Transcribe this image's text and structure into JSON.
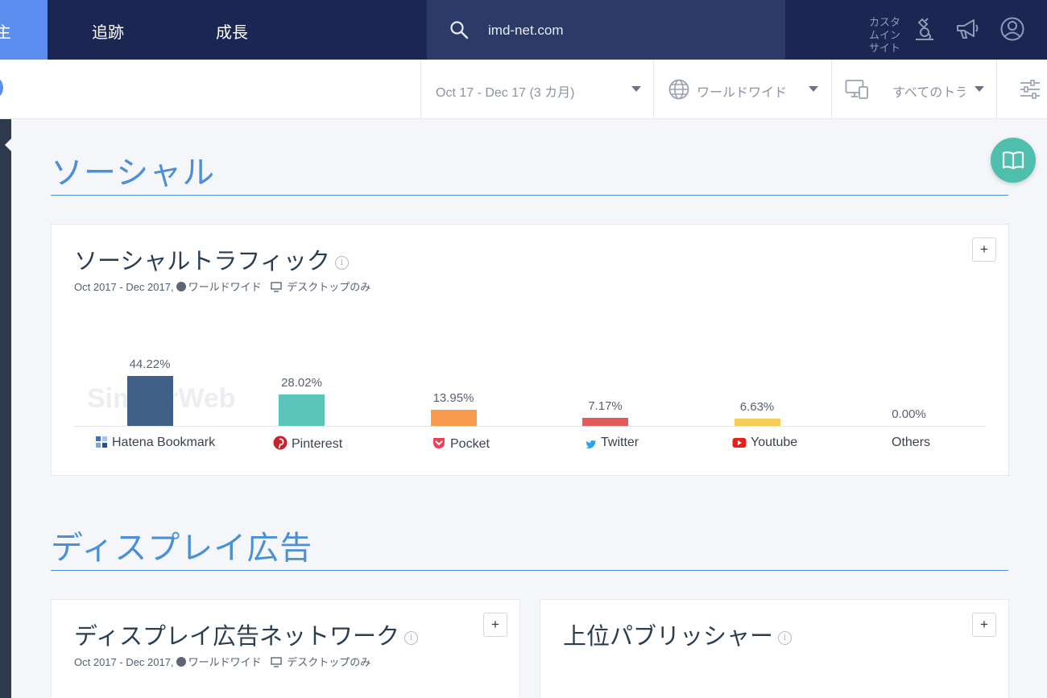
{
  "topnav": {
    "active_label": "主",
    "links": [
      "追跡",
      "成長"
    ],
    "search_value": "imd-net.com",
    "custom_label": "カスタムインサイト"
  },
  "subheader": {
    "date_range": "Oct 17 - Dec 17 (3 カ月)",
    "region": "ワールドワイド",
    "traffic": "すべてのトラ"
  },
  "social": {
    "section_title": "ソーシャル",
    "card_title": "ソーシャルトラフィック",
    "info_glyph": "i",
    "meta_date": "Oct 2017 - Dec 2017,",
    "meta_region": "ワールドワイド",
    "meta_device": "デスクトップのみ",
    "plus": "+",
    "watermark": "SimilarWeb"
  },
  "chart_data": {
    "type": "bar",
    "categories": [
      "Hatena Bookmark",
      "Pinterest",
      "Pocket",
      "Twitter",
      "Youtube",
      "Others"
    ],
    "values": [
      44.22,
      28.02,
      13.95,
      7.17,
      6.63,
      0.0
    ],
    "labels": [
      "44.22%",
      "28.02%",
      "13.95%",
      "7.17%",
      "6.63%",
      "0.00%"
    ],
    "colors": [
      "#3f5f86",
      "#5cc5b9",
      "#f79c4e",
      "#e35b5b",
      "#f7cd56",
      "#cccccc"
    ],
    "icons": [
      "hatena-icon",
      "pinterest-icon",
      "pocket-icon",
      "twitter-icon",
      "youtube-icon",
      ""
    ],
    "ylim": [
      0,
      44.22
    ]
  },
  "display": {
    "section_title": "ディスプレイ広告",
    "network_title": "ディスプレイ広告ネットワーク",
    "network_meta_date": "Oct 2017 - Dec 2017,",
    "network_meta_region": "ワールドワイド",
    "network_meta_device": "デスクトップのみ",
    "publisher_title": "上位パブリッシャー",
    "plus": "+"
  }
}
